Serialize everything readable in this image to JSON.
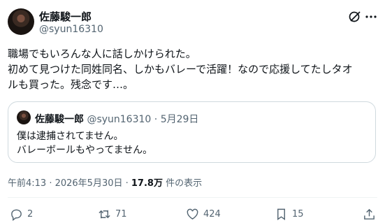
{
  "author": {
    "name": "佐藤駿一郎",
    "handle": "@syun16310"
  },
  "body": {
    "line1": "職場でもいろんな人に話しかけられた。",
    "line2": "初めて見つけた同姓同名、しかもバレーで活躍！なので応援してたしタオ",
    "line3": "ルも買った。残念です…。"
  },
  "quote": {
    "name": "佐藤駿一郎",
    "handle": "@syun16310",
    "sep": " · ",
    "date": "5月29日",
    "line1": "僕は逮捕されてません。",
    "line2": "バレーボールもやってません。"
  },
  "meta": {
    "time": "午前4:13 · 2026年5月30日 · ",
    "views": "17.8万",
    "views_suffix": " 件の表示"
  },
  "actions": {
    "replies": "2",
    "reposts": "71",
    "likes": "424",
    "bookmarks": "15"
  },
  "icons": [
    "grok-icon",
    "more-icon",
    "reply-icon",
    "repost-icon",
    "like-icon",
    "bookmark-icon",
    "share-icon"
  ]
}
